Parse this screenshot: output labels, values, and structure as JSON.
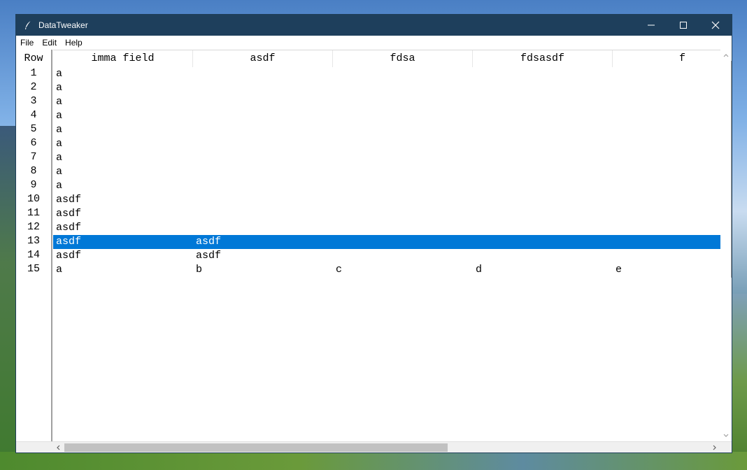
{
  "window": {
    "title": "DataTweaker"
  },
  "menu": [
    "File",
    "Edit",
    "Help"
  ],
  "table": {
    "row_header": "Row",
    "columns": [
      "imma field",
      "asdf",
      "fdsa",
      "fdsasdf",
      "f"
    ],
    "rows": [
      {
        "num": "1",
        "cells": [
          "a",
          "",
          "",
          "",
          ""
        ]
      },
      {
        "num": "2",
        "cells": [
          "a",
          "",
          "",
          "",
          ""
        ]
      },
      {
        "num": "3",
        "cells": [
          "a",
          "",
          "",
          "",
          ""
        ]
      },
      {
        "num": "4",
        "cells": [
          "a",
          "",
          "",
          "",
          ""
        ]
      },
      {
        "num": "5",
        "cells": [
          "a",
          "",
          "",
          "",
          ""
        ]
      },
      {
        "num": "6",
        "cells": [
          "a",
          "",
          "",
          "",
          ""
        ]
      },
      {
        "num": "7",
        "cells": [
          "a",
          "",
          "",
          "",
          ""
        ]
      },
      {
        "num": "8",
        "cells": [
          "a",
          "",
          "",
          "",
          ""
        ]
      },
      {
        "num": "9",
        "cells": [
          "a",
          "",
          "",
          "",
          ""
        ]
      },
      {
        "num": "10",
        "cells": [
          "asdf",
          "",
          "",
          "",
          ""
        ]
      },
      {
        "num": "11",
        "cells": [
          "asdf",
          "",
          "",
          "",
          ""
        ]
      },
      {
        "num": "12",
        "cells": [
          "asdf",
          "",
          "",
          "",
          ""
        ]
      },
      {
        "num": "13",
        "cells": [
          "asdf",
          "asdf",
          "",
          "",
          ""
        ],
        "selected": true
      },
      {
        "num": "14",
        "cells": [
          "asdf",
          "asdf",
          "",
          "",
          ""
        ]
      },
      {
        "num": "15",
        "cells": [
          "a",
          "b",
          "c",
          "d",
          "e"
        ]
      }
    ]
  },
  "colors": {
    "titlebar": "#1e3f5c",
    "selection": "#0078d7"
  }
}
